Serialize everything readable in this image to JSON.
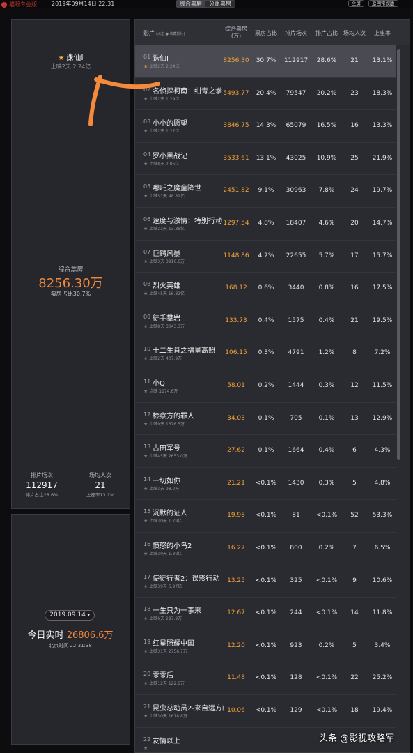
{
  "topbar": {
    "brand": "猫眼专业版",
    "date": "2019年09月14日 22:31",
    "tabs": [
      "综合票房",
      "分账票房"
    ],
    "btn_fullscreen": "全屏",
    "btn_return": "返回常规版"
  },
  "movie_panel": {
    "title": "诛仙Ⅰ",
    "subtitle": "上映2天 2.24亿",
    "bo_label": "综合票房",
    "bo_value": "8256.30万",
    "bo_share": "票房占比30.7%",
    "stat_left": {
      "label": "排片场次",
      "value": "112917",
      "sub": "排片占比28.6%"
    },
    "stat_right": {
      "label": "场均人次",
      "value": "21",
      "sub": "上座率13.1%"
    }
  },
  "realtime_panel": {
    "date": "2019.09.14",
    "label": "今日实时",
    "value": "26806.6万",
    "time": "北京时间 22:31:38"
  },
  "table": {
    "headers": {
      "film": "影片",
      "legend": "(点击 ● 收藏影片)",
      "bo": "综合票房(万)",
      "bo_share": "票房占比",
      "sessions": "排片场次",
      "session_share": "排片占比",
      "avg_people": "场均人次",
      "occupancy": "上座率"
    },
    "rows": [
      {
        "rank": "01",
        "name": "诛仙Ⅰ",
        "meta": "上映2天 2.24亿",
        "bo": "8256.30",
        "bo_share": "30.7%",
        "sessions": "112917",
        "session_share": "28.6%",
        "avg": "21",
        "occ": "13.1%",
        "selected": true
      },
      {
        "rank": "02",
        "name": "名侦探柯南：绀青之拳",
        "meta": "上映2天 1.29亿",
        "bo": "5493.77",
        "bo_share": "20.4%",
        "sessions": "79547",
        "session_share": "20.2%",
        "avg": "23",
        "occ": "18.3%"
      },
      {
        "rank": "03",
        "name": "小小的愿望",
        "meta": "上映2天 1.27亿",
        "bo": "3846.75",
        "bo_share": "14.3%",
        "sessions": "65079",
        "session_share": "16.5%",
        "avg": "16",
        "occ": "13.3%"
      },
      {
        "rank": "04",
        "name": "罗小黑战记",
        "meta": "上映8天 2.05亿",
        "bo": "3533.61",
        "bo_share": "13.1%",
        "sessions": "43025",
        "session_share": "10.9%",
        "avg": "25",
        "occ": "21.9%"
      },
      {
        "rank": "05",
        "name": "哪吒之魔童降世",
        "meta": "上映51天 48.81亿",
        "bo": "2451.82",
        "bo_share": "9.1%",
        "sessions": "30963",
        "session_share": "7.8%",
        "avg": "24",
        "occ": "19.7%"
      },
      {
        "rank": "06",
        "name": "速度与激情：特别行动",
        "meta": "上映23天 13.86亿",
        "bo": "1297.54",
        "bo_share": "4.8%",
        "sessions": "18407",
        "session_share": "4.6%",
        "avg": "20",
        "occ": "14.7%"
      },
      {
        "rank": "07",
        "name": "巨鳄风暴",
        "meta": "上映3天 3916.6万",
        "bo": "1148.86",
        "bo_share": "4.2%",
        "sessions": "22655",
        "session_share": "5.7%",
        "avg": "17",
        "occ": "15.7%"
      },
      {
        "rank": "08",
        "name": "烈火英雄",
        "meta": "上映45天 16.82亿",
        "bo": "168.12",
        "bo_share": "0.6%",
        "sessions": "3440",
        "session_share": "0.8%",
        "avg": "16",
        "occ": "17.5%"
      },
      {
        "rank": "09",
        "name": "徒手攀岩",
        "meta": "上映8天 3043.3万",
        "bo": "133.73",
        "bo_share": "0.4%",
        "sessions": "1575",
        "session_share": "0.4%",
        "avg": "21",
        "occ": "19.5%"
      },
      {
        "rank": "10",
        "name": "十二生肖之福星高照",
        "meta": "上映2天 407.9万",
        "bo": "106.15",
        "bo_share": "0.3%",
        "sessions": "4791",
        "session_share": "1.2%",
        "avg": "8",
        "occ": "7.2%"
      },
      {
        "rank": "11",
        "name": "小Q",
        "meta": "点映 1174.6万",
        "bo": "58.01",
        "bo_share": "0.2%",
        "sessions": "1444",
        "session_share": "0.3%",
        "avg": "12",
        "occ": "11.5%"
      },
      {
        "rank": "12",
        "name": "检察方的罪人",
        "meta": "上映9天 1376.5万",
        "bo": "34.03",
        "bo_share": "0.1%",
        "sessions": "705",
        "session_share": "0.1%",
        "avg": "13",
        "occ": "12.9%"
      },
      {
        "rank": "13",
        "name": "古田军号",
        "meta": "上映45天 2653.0万",
        "bo": "27.62",
        "bo_share": "0.1%",
        "sessions": "1664",
        "session_share": "0.4%",
        "avg": "6",
        "occ": "4.3%"
      },
      {
        "rank": "14",
        "name": "一切如你",
        "meta": "上映3天 98.0万",
        "bo": "21.21",
        "bo_share": "<0.1%",
        "sessions": "1430",
        "session_share": "0.3%",
        "avg": "5",
        "occ": "4.8%"
      },
      {
        "rank": "15",
        "name": "沉默的证人",
        "meta": "上映30天 1.79亿",
        "bo": "19.98",
        "bo_share": "<0.1%",
        "sessions": "81",
        "session_share": "<0.1%",
        "avg": "52",
        "occ": "53.3%"
      },
      {
        "rank": "16",
        "name": "愤怒的小鸟2",
        "meta": "上映30天 1.39亿",
        "bo": "16.27",
        "bo_share": "<0.1%",
        "sessions": "800",
        "session_share": "0.2%",
        "avg": "7",
        "occ": "6.5%"
      },
      {
        "rank": "17",
        "name": "使徒行者2：谍影行动",
        "meta": "上映39天 6.97亿",
        "bo": "13.25",
        "bo_share": "<0.1%",
        "sessions": "325",
        "session_share": "<0.1%",
        "avg": "9",
        "occ": "10.6%"
      },
      {
        "rank": "18",
        "name": "一生只为一事来",
        "meta": "上映6天 297.9万",
        "bo": "12.67",
        "bo_share": "<0.1%",
        "sessions": "244",
        "session_share": "<0.1%",
        "avg": "14",
        "occ": "11.8%"
      },
      {
        "rank": "19",
        "name": "红星照耀中国",
        "meta": "上映31天 2756.7万",
        "bo": "12.20",
        "bo_share": "<0.1%",
        "sessions": "923",
        "session_share": "0.2%",
        "avg": "5",
        "occ": "3.4%"
      },
      {
        "rank": "20",
        "name": "零零后",
        "meta": "上映12天 122.6万",
        "bo": "11.48",
        "bo_share": "<0.1%",
        "sessions": "128",
        "session_share": "<0.1%",
        "avg": "22",
        "occ": "25.2%"
      },
      {
        "rank": "21",
        "name": "昆虫总动员2-来自远方的后援军",
        "meta": "上映30天 1618.8万",
        "bo": "10.06",
        "bo_share": "<0.1%",
        "sessions": "129",
        "session_share": "<0.1%",
        "avg": "18",
        "occ": "19.4%"
      },
      {
        "rank": "22",
        "name": "友情以上",
        "meta": "",
        "bo": "",
        "bo_share": "",
        "sessions": "",
        "session_share": "",
        "avg": "",
        "occ": ""
      }
    ]
  },
  "watermark": "头条 @影视攻略军",
  "colors": {
    "accent_orange": "#f2883a",
    "star": "#f2b233",
    "brand_red": "#c5372f",
    "annotation": "#f58a3c"
  }
}
